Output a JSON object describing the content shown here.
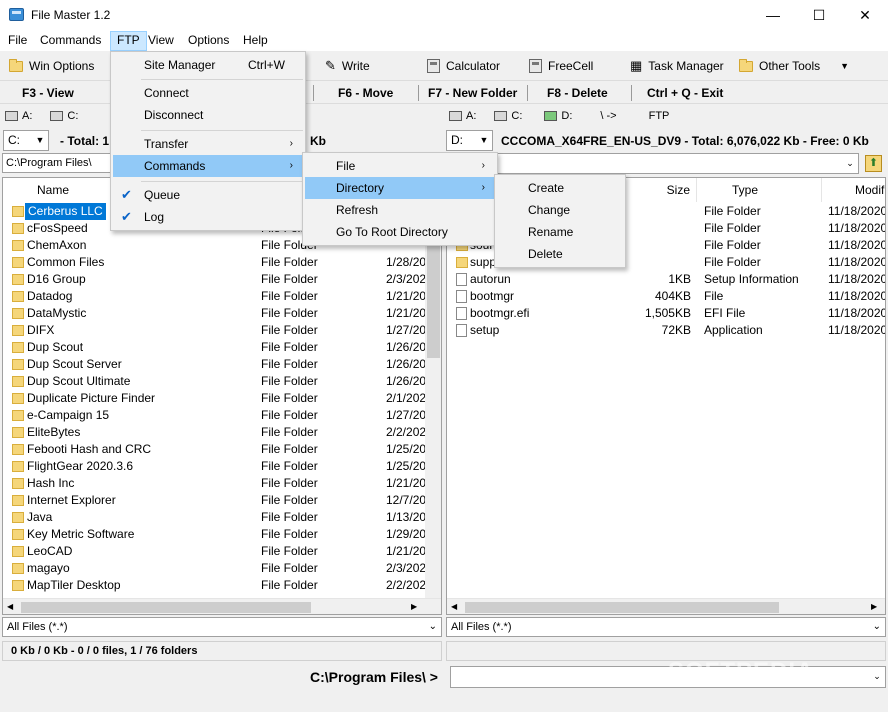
{
  "window": {
    "title": "File Master 1.2",
    "minimize": "—",
    "maximize": "☐",
    "close": "✕"
  },
  "menubar": [
    "File",
    "Commands",
    "FTP",
    "View",
    "Options",
    "Help"
  ],
  "toolbar": {
    "win_options": "Win Options",
    "write": "Write",
    "calculator": "Calculator",
    "freecell": "FreeCell",
    "task_manager": "Task Manager",
    "other_tools": "Other Tools"
  },
  "fkeys": {
    "f3": "F3 - View",
    "f6": "F6 - Move",
    "f7": "F7 - New Folder",
    "f8": "F8 - Delete",
    "exit": "Ctrl + Q - Exit"
  },
  "left": {
    "drives": [
      "A:",
      "C:"
    ],
    "drive_combo": "C:",
    "total": "- Total: 1",
    "total_suffix": "Kb",
    "path": "C:\\Program Files\\",
    "col_name": "Name",
    "filter": "All Files (*.*)",
    "rows": [
      {
        "name": "Cerberus LLC",
        "type": "",
        "date": ""
      },
      {
        "name": "cFosSpeed",
        "type": "File Folder",
        "date": ""
      },
      {
        "name": "ChemAxon",
        "type": "File Folder",
        "date": ""
      },
      {
        "name": "Common Files",
        "type": "File Folder",
        "date": "1/28/20"
      },
      {
        "name": "D16 Group",
        "type": "File Folder",
        "date": "2/3/202"
      },
      {
        "name": "Datadog",
        "type": "File Folder",
        "date": "1/21/20"
      },
      {
        "name": "DataMystic",
        "type": "File Folder",
        "date": "1/21/20"
      },
      {
        "name": "DIFX",
        "type": "File Folder",
        "date": "1/27/20"
      },
      {
        "name": "Dup Scout",
        "type": "File Folder",
        "date": "1/26/20"
      },
      {
        "name": "Dup Scout Server",
        "type": "File Folder",
        "date": "1/26/20"
      },
      {
        "name": "Dup Scout Ultimate",
        "type": "File Folder",
        "date": "1/26/20"
      },
      {
        "name": "Duplicate Picture Finder",
        "type": "File Folder",
        "date": "2/1/202"
      },
      {
        "name": "e-Campaign 15",
        "type": "File Folder",
        "date": "1/27/20"
      },
      {
        "name": "EliteBytes",
        "type": "File Folder",
        "date": "2/2/202"
      },
      {
        "name": "Febooti Hash and CRC",
        "type": "File Folder",
        "date": "1/25/20"
      },
      {
        "name": "FlightGear 2020.3.6",
        "type": "File Folder",
        "date": "1/25/20"
      },
      {
        "name": "Hash Inc",
        "type": "File Folder",
        "date": "1/21/20"
      },
      {
        "name": "Internet Explorer",
        "type": "File Folder",
        "date": "12/7/20"
      },
      {
        "name": "Java",
        "type": "File Folder",
        "date": "1/13/20"
      },
      {
        "name": "Key Metric Software",
        "type": "File Folder",
        "date": "1/29/20"
      },
      {
        "name": "LeoCAD",
        "type": "File Folder",
        "date": "1/21/20"
      },
      {
        "name": "magayo",
        "type": "File Folder",
        "date": "2/3/202"
      },
      {
        "name": "MapTiler Desktop",
        "type": "File Folder",
        "date": "2/2/202"
      }
    ]
  },
  "right": {
    "drives": [
      "A:",
      "C:",
      "D:",
      "\\ ->",
      "FTP"
    ],
    "drive_combo": "D:",
    "total": "CCCOMA_X64FRE_EN-US_DV9 - Total: 6,076,022 Kb - Free: 0 Kb",
    "col_size": "Size",
    "col_type": "Type",
    "col_modified": "Modifi",
    "filter": "All Files (*.*)",
    "rows": [
      {
        "name": "",
        "size": "",
        "type": "File Folder",
        "date": "11/18/2020"
      },
      {
        "name": "",
        "size": "",
        "type": "File Folder",
        "date": "11/18/2020"
      },
      {
        "name": "sour",
        "size": "",
        "type": "File Folder",
        "date": "11/18/2020"
      },
      {
        "name": "supp",
        "size": "",
        "type": "File Folder",
        "date": "11/18/2020"
      },
      {
        "name": "autorun",
        "size": "1KB",
        "type": "Setup Information",
        "date": "11/18/2020"
      },
      {
        "name": "bootmgr",
        "size": "404KB",
        "type": "File",
        "date": "11/18/2020"
      },
      {
        "name": "bootmgr.efi",
        "size": "1,505KB",
        "type": "EFI File",
        "date": "11/18/2020"
      },
      {
        "name": "setup",
        "size": "72KB",
        "type": "Application",
        "date": "11/18/2020"
      }
    ]
  },
  "status_left": "0 Kb / 0 Kb - 0 / 0 files, 1 / 76 folders",
  "command_path": "C:\\Program Files\\ >",
  "watermark": "SOFTPEDIA",
  "ftp_menu": {
    "items": [
      {
        "label": "Site Manager",
        "shortcut": "Ctrl+W"
      },
      {
        "label": "Connect"
      },
      {
        "label": "Disconnect"
      },
      {
        "label": "Transfer",
        "sub": "›"
      },
      {
        "label": "Commands",
        "sub": "›"
      },
      {
        "label": "Queue",
        "check": "✔"
      },
      {
        "label": "Log",
        "check": "✔"
      }
    ]
  },
  "commands_menu": [
    "File",
    "Directory",
    "Refresh",
    "Go To Root Directory"
  ],
  "directory_menu": [
    "Create",
    "Change",
    "Rename",
    "Delete"
  ]
}
